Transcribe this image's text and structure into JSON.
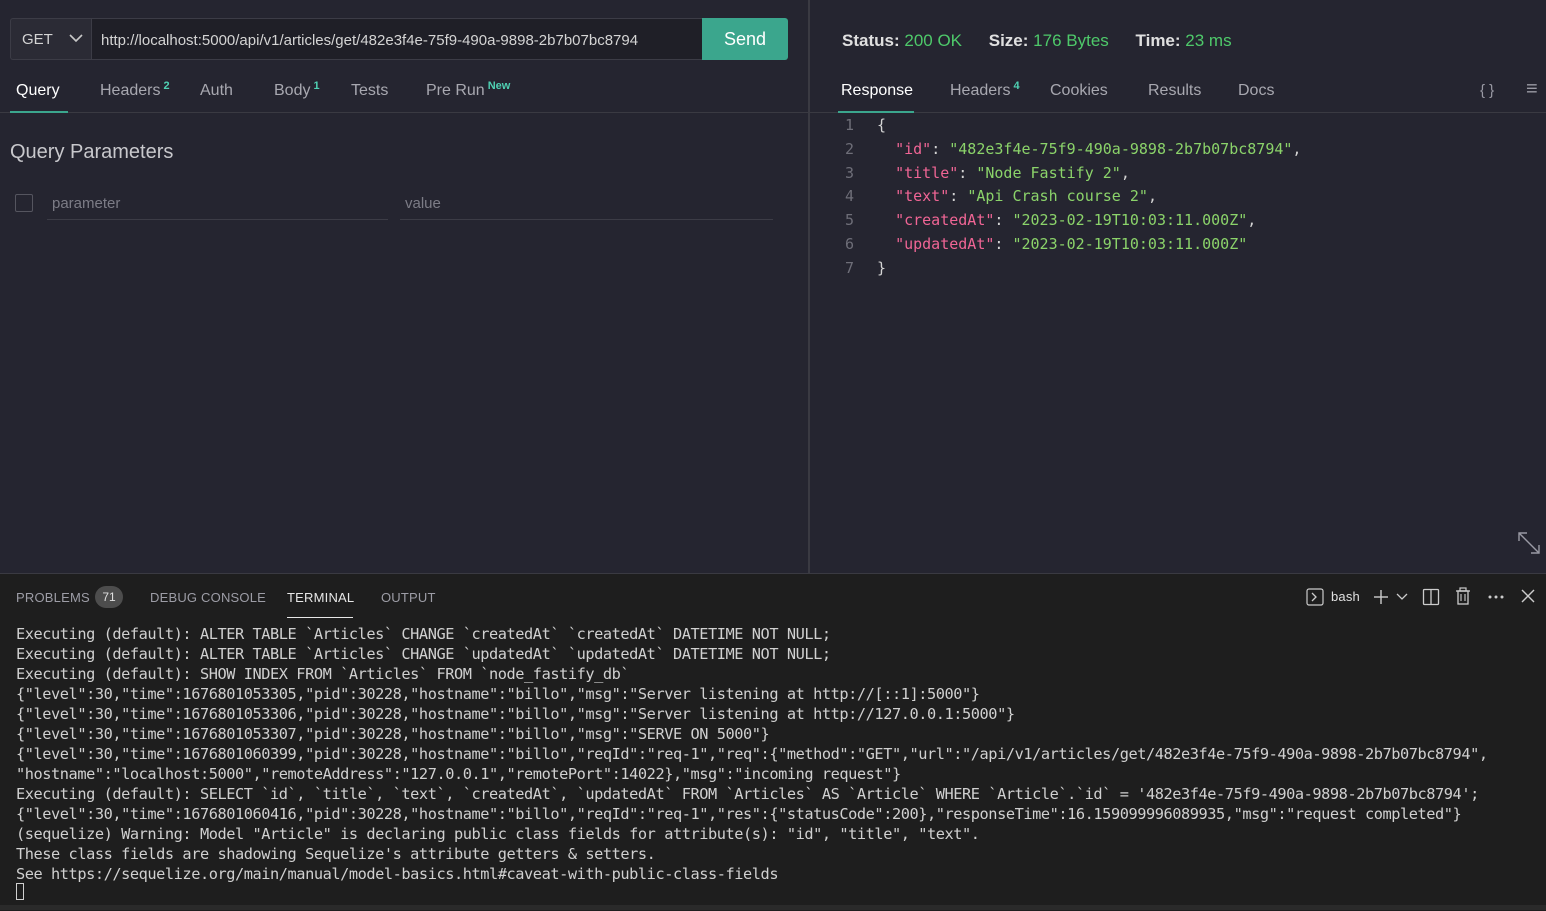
{
  "request": {
    "method": "GET",
    "url": "http://localhost:5000/api/v1/articles/get/482e3f4e-75f9-490a-9898-2b7b07bc8794",
    "send_label": "Send"
  },
  "request_tabs": [
    {
      "label": "Query",
      "sup": ""
    },
    {
      "label": "Headers",
      "sup": "2"
    },
    {
      "label": "Auth",
      "sup": ""
    },
    {
      "label": "Body",
      "sup": "1"
    },
    {
      "label": "Tests",
      "sup": ""
    },
    {
      "label": "Pre Run",
      "sup": "New"
    }
  ],
  "query": {
    "title": "Query Parameters",
    "param_placeholder": "parameter",
    "value_placeholder": "value"
  },
  "status": {
    "status_label": "Status:",
    "status_value": "200 OK",
    "size_label": "Size:",
    "size_value": "176 Bytes",
    "time_label": "Time:",
    "time_value": "23 ms"
  },
  "response_tabs": [
    {
      "label": "Response",
      "sup": ""
    },
    {
      "label": "Headers",
      "sup": "4"
    },
    {
      "label": "Cookies",
      "sup": ""
    },
    {
      "label": "Results",
      "sup": ""
    },
    {
      "label": "Docs",
      "sup": ""
    }
  ],
  "response_icons": {
    "braces": "{ }",
    "menu": "≡"
  },
  "response_lines": [
    {
      "n": "1",
      "open": "{"
    },
    {
      "n": "2",
      "key": "\"id\"",
      "val": "\"482e3f4e-75f9-490a-9898-2b7b07bc8794\"",
      "comma": ","
    },
    {
      "n": "3",
      "key": "\"title\"",
      "val": "\"Node Fastify 2\"",
      "comma": ","
    },
    {
      "n": "4",
      "key": "\"text\"",
      "val": "\"Api Crash course 2\"",
      "comma": ","
    },
    {
      "n": "5",
      "key": "\"createdAt\"",
      "val": "\"2023-02-19T10:03:11.000Z\"",
      "comma": ","
    },
    {
      "n": "6",
      "key": "\"updatedAt\"",
      "val": "\"2023-02-19T10:03:11.000Z\"",
      "comma": ""
    },
    {
      "n": "7",
      "open": "}"
    }
  ],
  "panel": {
    "tabs": [
      "PROBLEMS",
      "DEBUG CONSOLE",
      "TERMINAL",
      "OUTPUT"
    ],
    "problems_count": "71",
    "shell": "bash"
  },
  "terminal_lines": [
    "Executing (default): ALTER TABLE `Articles` CHANGE `createdAt` `createdAt` DATETIME NOT NULL;",
    "Executing (default): ALTER TABLE `Articles` CHANGE `updatedAt` `updatedAt` DATETIME NOT NULL;",
    "Executing (default): SHOW INDEX FROM `Articles` FROM `node_fastify_db`",
    "{\"level\":30,\"time\":1676801053305,\"pid\":30228,\"hostname\":\"billo\",\"msg\":\"Server listening at http://[::1]:5000\"}",
    "{\"level\":30,\"time\":1676801053306,\"pid\":30228,\"hostname\":\"billo\",\"msg\":\"Server listening at http://127.0.0.1:5000\"}",
    "{\"level\":30,\"time\":1676801053307,\"pid\":30228,\"hostname\":\"billo\",\"msg\":\"SERVE ON 5000\"}",
    "{\"level\":30,\"time\":1676801060399,\"pid\":30228,\"hostname\":\"billo\",\"reqId\":\"req-1\",\"req\":{\"method\":\"GET\",\"url\":\"/api/v1/articles/get/482e3f4e-75f9-490a-9898-2b7b07bc8794\",",
    "\"hostname\":\"localhost:5000\",\"remoteAddress\":\"127.0.0.1\",\"remotePort\":14022},\"msg\":\"incoming request\"}",
    "Executing (default): SELECT `id`, `title`, `text`, `createdAt`, `updatedAt` FROM `Articles` AS `Article` WHERE `Article`.`id` = '482e3f4e-75f9-490a-9898-2b7b07bc8794';",
    "{\"level\":30,\"time\":1676801060416,\"pid\":30228,\"hostname\":\"billo\",\"reqId\":\"req-1\",\"res\":{\"statusCode\":200},\"responseTime\":16.159099996089935,\"msg\":\"request completed\"}",
    "(sequelize) Warning: Model \"Article\" is declaring public class fields for attribute(s): \"id\", \"title\", \"text\".",
    "These class fields are shadowing Sequelize's attribute getters & setters.",
    "See https://sequelize.org/main/manual/model-basics.html#caveat-with-public-class-fields"
  ]
}
